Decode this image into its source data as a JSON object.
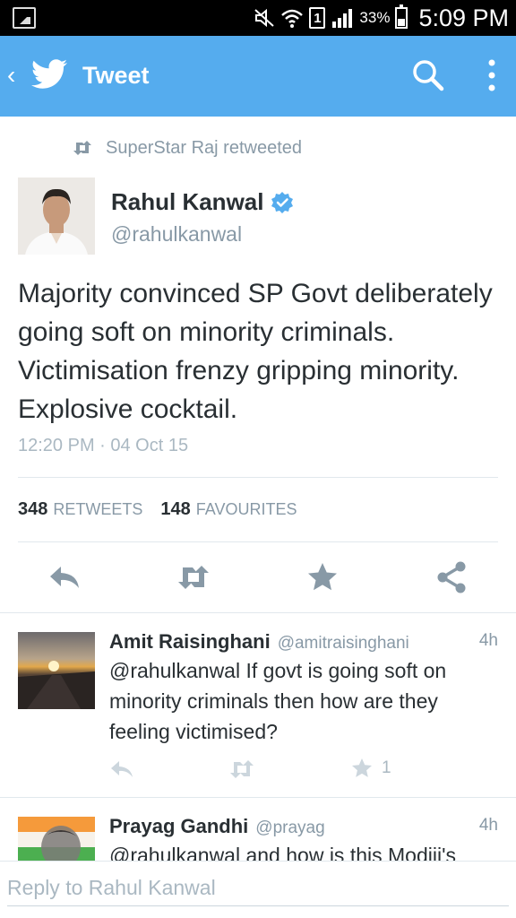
{
  "status_bar": {
    "battery": "33%",
    "time": "5:09 PM",
    "sim": "1",
    "icons": [
      "gallery-icon",
      "mute-icon",
      "wifi-icon",
      "sim-icon",
      "signal-icon",
      "battery-icon"
    ]
  },
  "app_bar": {
    "back": "‹",
    "title": "Tweet",
    "icons": [
      "twitter-bird-icon",
      "search-icon",
      "more-vert-icon"
    ]
  },
  "tweet": {
    "retweeted_by": "SuperStar Raj retweeted",
    "author_name": "Rahul Kanwal",
    "author_handle": "@rahulkanwal",
    "text": "Majority convinced SP Govt deliberately going soft on minority criminals. Victimisation frenzy gripping minority. Explosive cocktail.",
    "timestamp": "12:20 PM · 04 Oct 15",
    "retweets": "348",
    "retweets_label": "RETWEETS",
    "favourites": "148",
    "favourites_label": "FAVOURITES",
    "actions": [
      "reply-icon",
      "retweet-icon",
      "favourite-icon",
      "share-icon"
    ]
  },
  "replies": [
    {
      "name": "Amit Raisinghani",
      "handle": "@amitraisinghani",
      "age": "4h",
      "text": "@rahulkanwal If govt is going soft on minority criminals then how are they feeling victimised?",
      "favourite_count": "1"
    },
    {
      "name": "Prayag Gandhi",
      "handle": "@prayag",
      "age": "4h",
      "text": "@rahulkanwal and how is this Modiji's"
    }
  ],
  "reply_bar": {
    "placeholder": "Reply to Rahul Kanwal"
  },
  "colors": {
    "twitter_blue": "#55acee",
    "verified_blue": "#55acee",
    "muted_text": "#8899a6",
    "icon_gray": "#8899a6"
  }
}
